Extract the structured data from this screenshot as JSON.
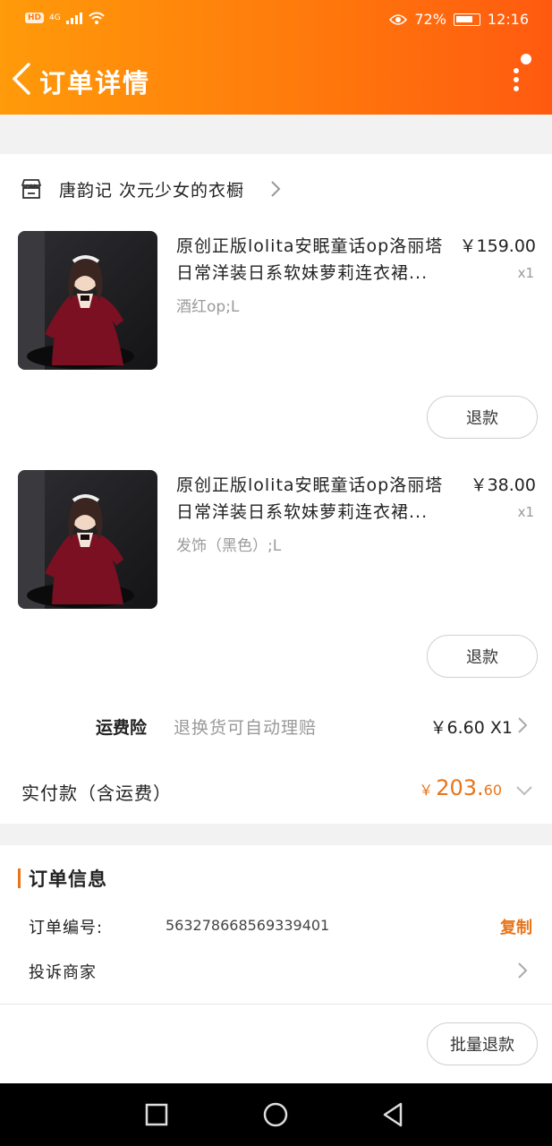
{
  "status_bar": {
    "hd": "HD",
    "network": "4G",
    "battery": "72%",
    "time": "12:16"
  },
  "nav": {
    "title": "订单详情"
  },
  "shop": {
    "name": "唐韵记 次元少女的衣橱"
  },
  "products": [
    {
      "title": "原创正版lolita安眠童话op洛丽塔日常洋装日系软妹萝莉连衣裙...",
      "price": "￥159.00",
      "qty": "x1",
      "spec": "酒红op;L",
      "refund_label": "退款"
    },
    {
      "title": "原创正版lolita安眠童话op洛丽塔日常洋装日系软妹萝莉连衣裙...",
      "price": "￥38.00",
      "qty": "x1",
      "spec": "发饰（黑色）;L",
      "refund_label": "退款"
    }
  ],
  "insurance": {
    "label": "运费险",
    "desc": "退换货可自动理赔",
    "price": "￥6.60 X1"
  },
  "total": {
    "label": "实付款（含运费）",
    "currency": "￥",
    "integer": "203.",
    "decimal": "60"
  },
  "order_info": {
    "title": "订单信息",
    "order_no_label": "订单编号:",
    "order_no": "563278668569339401",
    "copy_label": "复制",
    "complain_label": "投诉商家"
  },
  "batch_refund_label": "批量退款",
  "colors": {
    "header_start": "#ff9a0a",
    "header_end": "#ff5a10",
    "accent": "#e8751a"
  }
}
